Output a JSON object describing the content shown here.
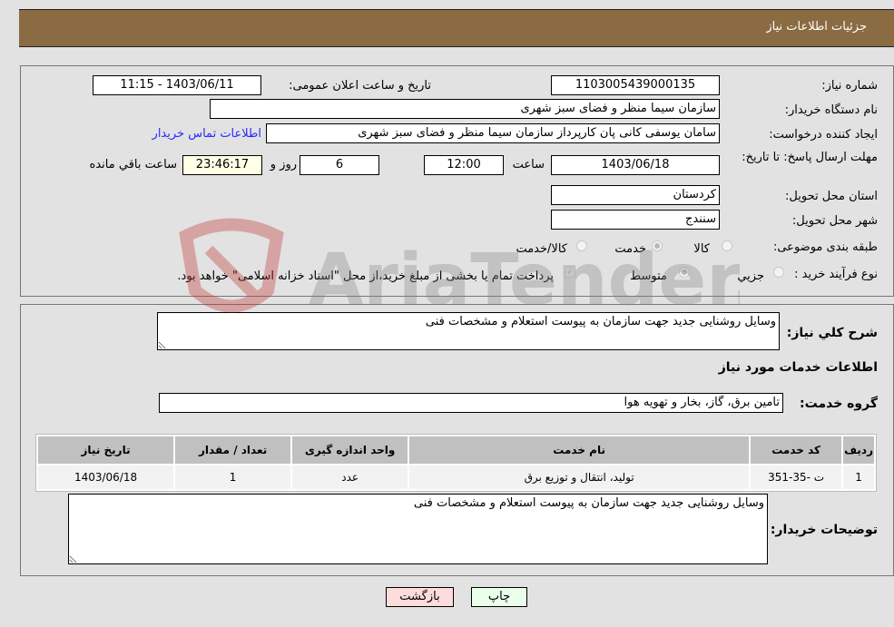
{
  "header": {
    "title": "جزئیات اطلاعات نیاز"
  },
  "form": {
    "need_number": {
      "label": "شماره نیاز:",
      "value": "1103005439000135"
    },
    "announce_datetime": {
      "label": "تاریخ و ساعت اعلان عمومی:",
      "value": "1403/06/11 - 11:15"
    },
    "buyer_org": {
      "label": "نام دستگاه خریدار:",
      "value": "سازمان سیما  منظر و فضای سبز شهری"
    },
    "requester": {
      "label": "ایجاد کننده درخواست:",
      "value": "سامان یوسفی کانی پان کارپرداز سازمان سیما  منظر و فضای سبز شهری"
    },
    "buyer_contact_link": "اطلاعات تماس خریدار",
    "deadline": {
      "label": "مهلت ارسال پاسخ: تا تاریخ:",
      "date": "1403/06/18",
      "time_label": "ساعت",
      "time": "12:00",
      "days": "6",
      "days_label": "روز و",
      "remaining": "23:46:17",
      "remaining_label": "ساعت باقي مانده"
    },
    "province": {
      "label": "استان محل تحویل:",
      "value": "کردستان"
    },
    "city": {
      "label": "شهر محل تحویل:",
      "value": "سنندج"
    },
    "category": {
      "label": "طبقه بندی موضوعی:",
      "options": [
        "کالا",
        "خدمت",
        "کالا/خدمت"
      ],
      "selected": "خدمت"
    },
    "purchase_type": {
      "label": "نوع فرآیند خرید :",
      "options": [
        "جزيي",
        "متوسط"
      ],
      "selected": "متوسط",
      "treasury_checkbox_label": "پرداخت تمام یا بخشی از مبلغ خرید،از محل \"اسناد خزانه اسلامی\" خواهد بود.",
      "treasury_checked": true
    }
  },
  "details": {
    "general_desc": {
      "label": "شرح کلي نیاز:",
      "value": "وسایل روشنایی جدید جهت سازمان به پیوست استعلام و مشخصات فنی"
    },
    "services_heading": "اطلاعات خدمات مورد نیاز",
    "service_group": {
      "label": "گروه خدمت:",
      "value": "تامین برق، گاز، بخار و تهویه هوا"
    },
    "table": {
      "headers": [
        "ردیف",
        "کد خدمت",
        "نام خدمت",
        "واحد اندازه گیری",
        "تعداد / مقدار",
        "تاریخ نیاز"
      ],
      "rows": [
        [
          "1",
          "ت -35-351",
          "تولید، انتقال و توزیع برق",
          "عدد",
          "1",
          "1403/06/18"
        ]
      ]
    },
    "buyer_notes": {
      "label": "توضیحات خریدار:",
      "value": "وسایل روشنایی جدید جهت سازمان به پیوست استعلام و مشخصات فنی"
    }
  },
  "buttons": {
    "print": "چاپ",
    "back": "بازگشت"
  },
  "watermark": "AriaTender.neT",
  "colors": {
    "header_bg": "#8b6b42",
    "print_bg": "#eaffea",
    "back_bg": "#ffdcdc",
    "link": "#2a2aff"
  }
}
